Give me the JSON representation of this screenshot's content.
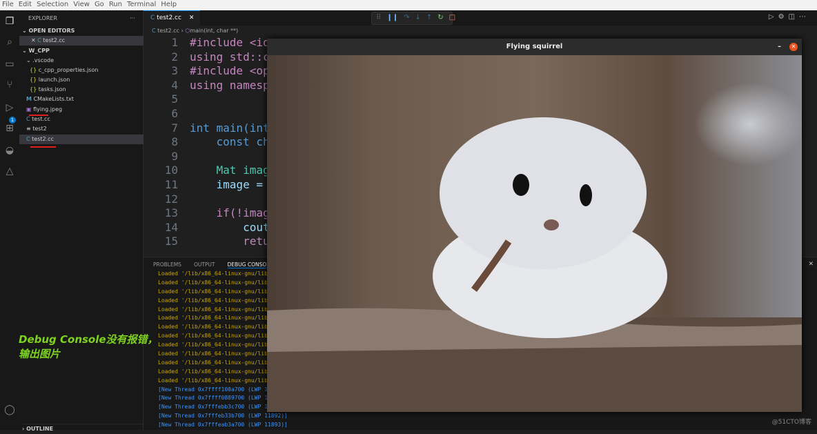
{
  "menu": [
    "File",
    "Edit",
    "Selection",
    "View",
    "Go",
    "Run",
    "Terminal",
    "Help"
  ],
  "explorer": {
    "title": "EXPLORER",
    "more": "···",
    "open_editors": "OPEN EDITORS",
    "open_file": "test2.cc",
    "folder": "W_CPP",
    "outline": "OUTLINE",
    "items": [
      {
        "label": ".vscode",
        "icon": "chevron-down"
      },
      {
        "label": "c_cpp_properties.json",
        "icon": "{}"
      },
      {
        "label": "launch.json",
        "icon": "{}"
      },
      {
        "label": "tasks.json",
        "icon": "{}"
      },
      {
        "label": "CMakeLists.txt",
        "icon": "M"
      },
      {
        "label": "flying.jpeg",
        "icon": "image"
      },
      {
        "label": "test.cc",
        "icon": "C"
      },
      {
        "label": "test2",
        "icon": "≡"
      },
      {
        "label": "test2.cc",
        "icon": "C"
      }
    ]
  },
  "debug_badge": "1",
  "editor": {
    "tab": "test2.cc",
    "breadcrumb_file": "test2.cc",
    "breadcrumb_symbol": "main(int, char **)",
    "lines": [
      {
        "n": "1",
        "t": "#include <io"
      },
      {
        "n": "2",
        "t": "using std::c"
      },
      {
        "n": "3",
        "t": "#include <op"
      },
      {
        "n": "4",
        "t": "using namesp"
      },
      {
        "n": "5",
        "t": ""
      },
      {
        "n": "6",
        "t": ""
      },
      {
        "n": "7",
        "t": "int main(int"
      },
      {
        "n": "8",
        "t": "    const ch"
      },
      {
        "n": "9",
        "t": ""
      },
      {
        "n": "10",
        "t": "    Mat imag"
      },
      {
        "n": "11",
        "t": "    image = "
      },
      {
        "n": "12",
        "t": ""
      },
      {
        "n": "13",
        "t": "    if(!imag"
      },
      {
        "n": "14",
        "t": "        cout"
      },
      {
        "n": "15",
        "t": "        retu"
      }
    ]
  },
  "panel": {
    "tabs": [
      "PROBLEMS",
      "OUTPUT",
      "DEBUG CONSOLE"
    ],
    "loaded": [
      "Loaded '/lib/x86_64-linux-gnu/libex",
      "Loaded '/lib/x86_64-linux-gnu/libuu",
      "Loaded '/lib/x86_64-linux-gnu/libXa",
      "Loaded '/lib/x86_64-linux-gnu/libXd",
      "Loaded '/lib/x86_64-linux-gnu/libqu",
      "Loaded '/lib/x86_64-linux-gnu/libsy",
      "Loaded '/lib/x86_64-linux-gnu/libbl",
      "Loaded '/lib/x86_64-linux-gnu/libpc",
      "Loaded '/lib/x86_64-linux-gnu/libda",
      "Loaded '/lib/x86_64-linux-gnu/libbs",
      "Loaded '/lib/x86_64-linux-gnu/liblz",
      "Loaded '/lib/x86_64-linux-gnu/libgc",
      "Loaded '/lib/x86_64-linux-gnu/libgp"
    ],
    "threads": [
      "[New Thread 0x7ffff108a700 (LWP 118",
      "[New Thread 0x7ffff0889700 (LWP 118",
      "[New Thread 0x7fffebb3c700 (LWP 118",
      "[New Thread 0x7fffeb33b700 (LWP 11892)]",
      "[New Thread 0x7fffeab3a700 (LWP 11893)]"
    ]
  },
  "image_window": {
    "title": "Flying squirrel"
  },
  "annotation": {
    "line1": "Debug Console没有报错，",
    "line2": "输出图片"
  },
  "watermark": "@51CTO博客",
  "colors": {
    "accent": "#0078d4",
    "annotation": "#7ed321",
    "underline": "#e02020",
    "loaded": "#cca700",
    "thread": "#3794ff"
  }
}
